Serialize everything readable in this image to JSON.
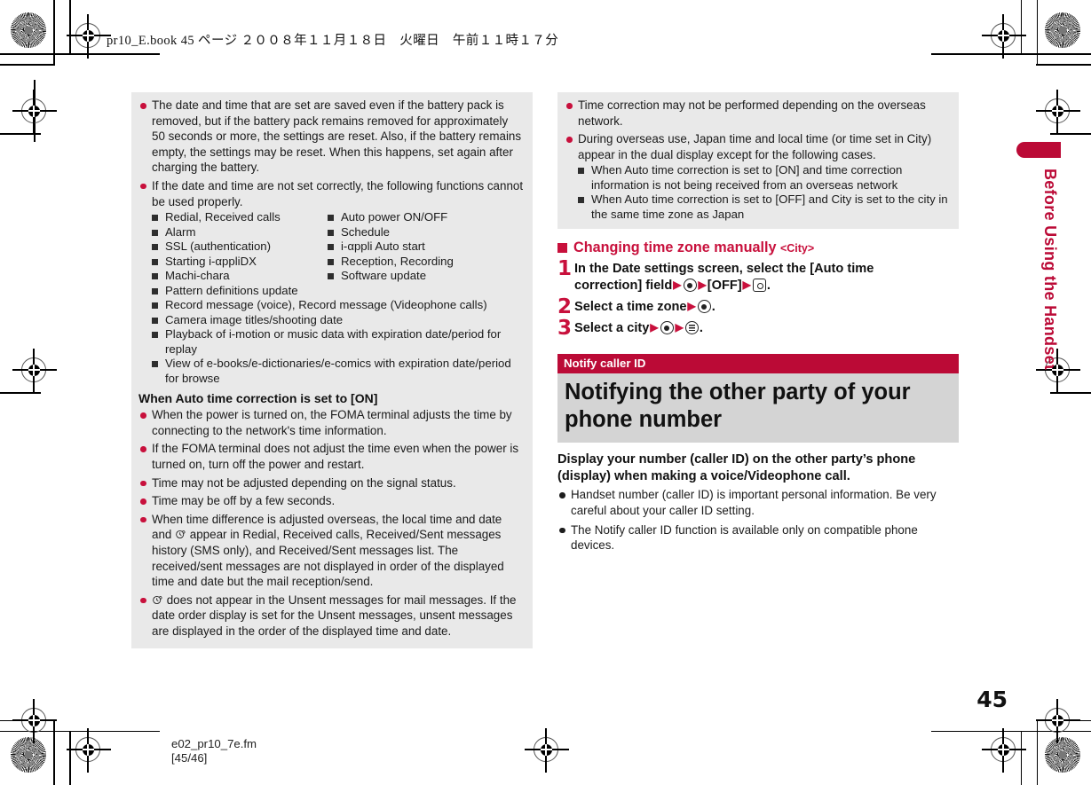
{
  "document": {
    "header_line": "pr10_E.book   45 ページ   ２００８年１１月１８日　火曜日　午前１１時１７分",
    "page_number": "45",
    "footer_filename": "e02_pr10_7e.fm",
    "footer_pages": "[45/46]",
    "side_tab_label": "Before Using the Handset",
    "accent_color": "#bb0a36",
    "bullet_red": "#c8103c",
    "panel_gray": "#e9e9e9",
    "title_gray": "#d4d4d4"
  },
  "left_column": {
    "notes": [
      "The date and time that are set are saved even if the battery pack is removed, but if the battery pack remains removed for approximately 50 seconds or more, the settings are reset. Also, if the battery remains empty, the settings may be reset. When this happens, set again after charging the battery.",
      "If the date and time are not set correctly, the following functions cannot be used properly."
    ],
    "function_list_col1": [
      "Redial, Received calls",
      "Alarm",
      "SSL (authentication)",
      "Starting i-αppliDX",
      "Machi-chara"
    ],
    "function_list_col2": [
      "Auto power ON/OFF",
      "Schedule",
      "i-αppli Auto start",
      "Reception, Recording",
      "Software update"
    ],
    "function_list_full": [
      "Pattern definitions update",
      "Record message (voice), Record message (Videophone calls)",
      "Camera image titles/shooting date",
      "Playback of i-motion or music data with expiration date/period for replay",
      "View of e-books/e-dictionaries/e-comics with expiration date/period for browse"
    ],
    "subheading": "When Auto time correction is set to [ON]",
    "auto_on_notes": [
      "When the power is turned on, the FOMA terminal adjusts the time by connecting to the network's time information.",
      "If the FOMA terminal does not adjust the time even when the power is turned on, turn off the power and restart.",
      "Time may not be adjusted depending on the signal status.",
      "Time may be off by a few seconds."
    ],
    "overseas_note_a_pre": "When time difference is adjusted overseas, the local time and date and ",
    "overseas_note_a_post": " appear in Redial, Received calls, Received/Sent messages history (SMS only), and Received/Sent messages list. The received/sent messages are not displayed in order of the displayed time and date but the mail reception/send.",
    "overseas_note_b_post": " does not appear in the Unsent messages for mail messages. If the date order display is set for the Unsent messages, unsent messages are displayed in the order of the displayed time and date."
  },
  "right_column": {
    "notes": [
      "Time correction may not be performed depending on the overseas network.",
      "During overseas use, Japan time and local time (or time set in City) appear in the dual display except for the following cases."
    ],
    "sub_notes": [
      "When Auto time correction is set to [ON] and time correction information is not being received from an overseas network",
      "When Auto time correction is set to [OFF] and City is set to the city in the same time zone as Japan"
    ],
    "heading": {
      "text": "Changing time zone manually ",
      "tag": "<City>"
    },
    "steps": [
      {
        "num": "1",
        "parts": [
          "In the Date settings screen, select the [Auto time correction] field",
          "▶",
          "KEY_CENTER",
          "▶",
          "[OFF]",
          "▶",
          "KEY_CAMERA",
          "."
        ]
      },
      {
        "num": "2",
        "parts": [
          "Select a time zone",
          "▶",
          "KEY_CENTER",
          "."
        ]
      },
      {
        "num": "3",
        "parts": [
          "Select a city",
          "▶",
          "KEY_CENTER",
          "▶",
          "KEY_MENU",
          "."
        ]
      }
    ],
    "step_texts": {
      "s1_a": "In the Date settings screen, select the [Auto time",
      "s1_b": "correction] field",
      "s1_off": "[OFF]",
      "s2": "Select a time zone",
      "s3": "Select a city"
    },
    "section": {
      "tag": "Notify caller ID",
      "title": "Notifying the other party of your phone number",
      "lead": "Display your number (caller ID) on the other party’s phone (display) when making a voice/Videophone call.",
      "notes": [
        "Handset number (caller ID) is important personal information. Be very careful about your caller ID setting.",
        "The Notify caller ID function is available only on compatible phone devices."
      ]
    }
  }
}
